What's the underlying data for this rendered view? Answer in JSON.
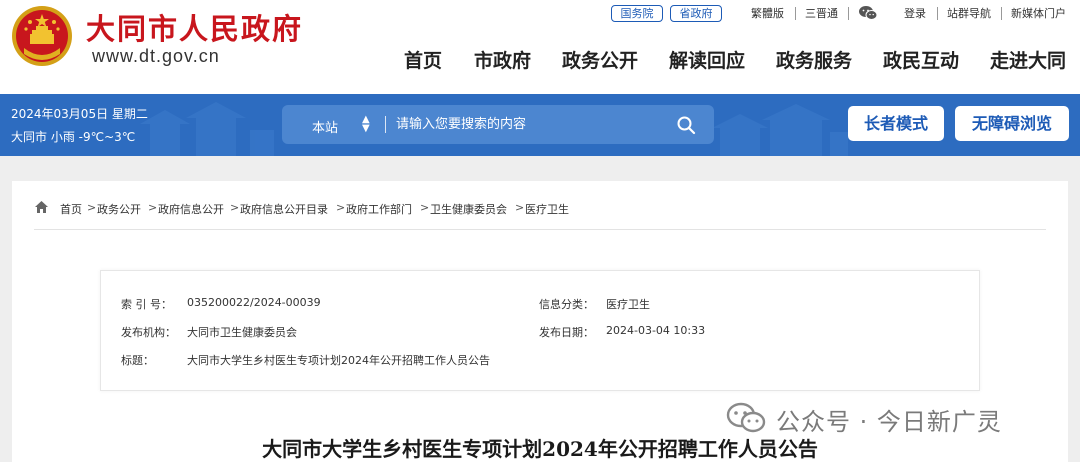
{
  "header": {
    "site_name": "大同市人民政府",
    "site_url": "www.dt.gov.cn",
    "top_links": {
      "state_council": "国务院",
      "province": "省政府",
      "traditional": "繁體版",
      "three_press": "三晋通",
      "login": "登录",
      "group_guide": "站群导航",
      "new_media": "新媒体门户"
    },
    "nav": [
      "首页",
      "市政府",
      "政务公开",
      "解读回应",
      "政务服务",
      "政民互动",
      "走进大同"
    ]
  },
  "banner": {
    "date": "2024年03月05日 星期二",
    "weather": "大同市 小雨 -9℃~3℃",
    "search_scope": "本站",
    "search_placeholder": "请输入您要搜索的内容",
    "elder_mode": "长者模式",
    "accessible_mode": "无障碍浏览"
  },
  "breadcrumb": [
    "首页",
    "政务公开",
    "政府信息公开",
    "政府信息公开目录",
    "政府工作部门",
    "卫生健康委员会",
    "医疗卫生"
  ],
  "metadata": {
    "index_label": "索 引 号：",
    "index_value": "035200022/2024-00039",
    "category_label": "信息分类：",
    "category_value": "医疗卫生",
    "publisher_label": "发布机构：",
    "publisher_value": "大同市卫生健康委员会",
    "date_label": "发布日期：",
    "date_value": "2024-03-04 10:33",
    "title_label": "标题：",
    "title_value": "大同市大学生乡村医生专项计划2024年公开招聘工作人员公告"
  },
  "document": {
    "title": "大同市大学生乡村医生专项计划2024年公开招聘工作人员公告"
  },
  "watermark": {
    "text": "公众号 · 今日新广灵"
  },
  "colors": {
    "brand_red": "#c8161d",
    "banner_blue": "#2d6cc0",
    "link_blue": "#1d5bb6"
  }
}
